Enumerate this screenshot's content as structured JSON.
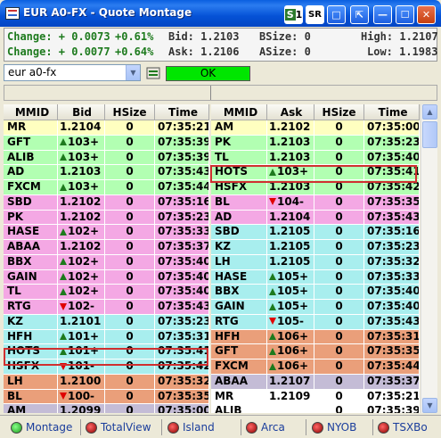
{
  "window": {
    "title": "EUR A0-FX - Quote Montage"
  },
  "quote": {
    "change1_label": "Change: + 0.0073",
    "change1_pct": "+0.61%",
    "change2_label": "Change: + 0.0077",
    "change2_pct": "+0.64%",
    "bid": "Bid: 1.2103",
    "ask": "Ask: 1.2106",
    "bsize": "BSize: 0",
    "asize": "ASize: 0",
    "high": "High: 1.2107",
    "low": "Low: 1.1983"
  },
  "toolbar": {
    "symbol_value": "eur a0-fx",
    "status": "OK"
  },
  "columns": {
    "bid": [
      "MMID",
      "Bid",
      "HSize",
      "Time"
    ],
    "ask": [
      "MMID",
      "Ask",
      "HSize",
      "Time"
    ]
  },
  "colors": {
    "yellow": "#ffffc0",
    "green": "#b2ffb2",
    "pink": "#f4a8e4",
    "cyan": "#a8eeee",
    "salmon": "#ea9f7a",
    "lavender": "#c4bcd6",
    "tick_up": "#1d7a1d",
    "tick_down": "#e00000",
    "highlight": "#d03030"
  },
  "bid_rows": [
    {
      "mmid": "MR",
      "price": "1.2104",
      "size": "0",
      "time": "07:35:21",
      "bg": "yellow",
      "tick": ""
    },
    {
      "mmid": "GFT",
      "price": "103+",
      "size": "0",
      "time": "07:35:39",
      "bg": "green",
      "tick": "up"
    },
    {
      "mmid": "ALIB",
      "price": "103+",
      "size": "0",
      "time": "07:35:39",
      "bg": "green",
      "tick": "up"
    },
    {
      "mmid": "AD",
      "price": "1.2103",
      "size": "0",
      "time": "07:35:43",
      "bg": "green",
      "tick": ""
    },
    {
      "mmid": "FXCM",
      "price": "103+",
      "size": "0",
      "time": "07:35:44",
      "bg": "green",
      "tick": "up"
    },
    {
      "mmid": "SBD",
      "price": "1.2102",
      "size": "0",
      "time": "07:35:16",
      "bg": "pink",
      "tick": ""
    },
    {
      "mmid": "PK",
      "price": "1.2102",
      "size": "0",
      "time": "07:35:23",
      "bg": "pink",
      "tick": ""
    },
    {
      "mmid": "HASE",
      "price": "102+",
      "size": "0",
      "time": "07:35:33",
      "bg": "pink",
      "tick": "up"
    },
    {
      "mmid": "ABAA",
      "price": "1.2102",
      "size": "0",
      "time": "07:35:37",
      "bg": "pink",
      "tick": ""
    },
    {
      "mmid": "BBX",
      "price": "102+",
      "size": "0",
      "time": "07:35:40",
      "bg": "pink",
      "tick": "up"
    },
    {
      "mmid": "GAIN",
      "price": "102+",
      "size": "0",
      "time": "07:35:40",
      "bg": "pink",
      "tick": "up"
    },
    {
      "mmid": "TL",
      "price": "102+",
      "size": "0",
      "time": "07:35:40",
      "bg": "pink",
      "tick": "up"
    },
    {
      "mmid": "RTG",
      "price": "102-",
      "size": "0",
      "time": "07:35:43",
      "bg": "pink",
      "tick": "down"
    },
    {
      "mmid": "KZ",
      "price": "1.2101",
      "size": "0",
      "time": "07:35:23",
      "bg": "cyan",
      "tick": ""
    },
    {
      "mmid": "HFH",
      "price": "101+",
      "size": "0",
      "time": "07:35:31",
      "bg": "cyan",
      "tick": "up"
    },
    {
      "mmid": "HOTS",
      "price": "101+",
      "size": "0",
      "time": "07:35:41",
      "bg": "cyan",
      "tick": "up"
    },
    {
      "mmid": "HSFX",
      "price": "101-",
      "size": "0",
      "time": "07:35:42",
      "bg": "cyan",
      "tick": "down"
    },
    {
      "mmid": "LH",
      "price": "1.2100",
      "size": "0",
      "time": "07:35:32",
      "bg": "salmon",
      "tick": ""
    },
    {
      "mmid": "BL",
      "price": "100-",
      "size": "0",
      "time": "07:35:35",
      "bg": "salmon",
      "tick": "down"
    },
    {
      "mmid": "AM",
      "price": "1.2099",
      "size": "0",
      "time": "07:35:00",
      "bg": "lav",
      "tick": ""
    }
  ],
  "ask_rows": [
    {
      "mmid": "AM",
      "price": "1.2102",
      "size": "0",
      "time": "07:35:00",
      "bg": "yellow",
      "tick": ""
    },
    {
      "mmid": "PK",
      "price": "1.2103",
      "size": "0",
      "time": "07:35:23",
      "bg": "green",
      "tick": ""
    },
    {
      "mmid": "TL",
      "price": "1.2103",
      "size": "0",
      "time": "07:35:40",
      "bg": "green",
      "tick": ""
    },
    {
      "mmid": "HOTS",
      "price": "103+",
      "size": "0",
      "time": "07:35:41",
      "bg": "green",
      "tick": "up"
    },
    {
      "mmid": "HSFX",
      "price": "1.2103",
      "size": "0",
      "time": "07:35:42",
      "bg": "green",
      "tick": ""
    },
    {
      "mmid": "BL",
      "price": "104-",
      "size": "0",
      "time": "07:35:35",
      "bg": "pink",
      "tick": "down"
    },
    {
      "mmid": "AD",
      "price": "1.2104",
      "size": "0",
      "time": "07:35:43",
      "bg": "pink",
      "tick": ""
    },
    {
      "mmid": "SBD",
      "price": "1.2105",
      "size": "0",
      "time": "07:35:16",
      "bg": "cyan",
      "tick": ""
    },
    {
      "mmid": "KZ",
      "price": "1.2105",
      "size": "0",
      "time": "07:35:23",
      "bg": "cyan",
      "tick": ""
    },
    {
      "mmid": "LH",
      "price": "1.2105",
      "size": "0",
      "time": "07:35:32",
      "bg": "cyan",
      "tick": ""
    },
    {
      "mmid": "HASE",
      "price": "105+",
      "size": "0",
      "time": "07:35:33",
      "bg": "cyan",
      "tick": "up"
    },
    {
      "mmid": "BBX",
      "price": "105+",
      "size": "0",
      "time": "07:35:40",
      "bg": "cyan",
      "tick": "up"
    },
    {
      "mmid": "GAIN",
      "price": "105+",
      "size": "0",
      "time": "07:35:40",
      "bg": "cyan",
      "tick": "up"
    },
    {
      "mmid": "RTG",
      "price": "105-",
      "size": "0",
      "time": "07:35:43",
      "bg": "cyan",
      "tick": "down"
    },
    {
      "mmid": "HFH",
      "price": "106+",
      "size": "0",
      "time": "07:35:31",
      "bg": "salmon",
      "tick": "up"
    },
    {
      "mmid": "GFT",
      "price": "106+",
      "size": "0",
      "time": "07:35:35",
      "bg": "salmon",
      "tick": "up"
    },
    {
      "mmid": "FXCM",
      "price": "106+",
      "size": "0",
      "time": "07:35:44",
      "bg": "salmon",
      "tick": "up"
    },
    {
      "mmid": "ABAA",
      "price": "1.2107",
      "size": "0",
      "time": "07:35:37",
      "bg": "lav",
      "tick": ""
    },
    {
      "mmid": "MR",
      "price": "1.2109",
      "size": "0",
      "time": "07:35:21",
      "bg": "white",
      "tick": ""
    },
    {
      "mmid": "ALIB",
      "price": "",
      "size": "0",
      "time": "07:35:39",
      "bg": "white",
      "tick": ""
    }
  ],
  "tabs": [
    {
      "label": "Montage",
      "state": "on"
    },
    {
      "label": "TotalView",
      "state": "off"
    },
    {
      "label": "Island",
      "state": "off"
    },
    {
      "label": "Arca",
      "state": "off"
    },
    {
      "label": "NYOB",
      "state": "off"
    },
    {
      "label": "TSXBo",
      "state": "off"
    }
  ]
}
